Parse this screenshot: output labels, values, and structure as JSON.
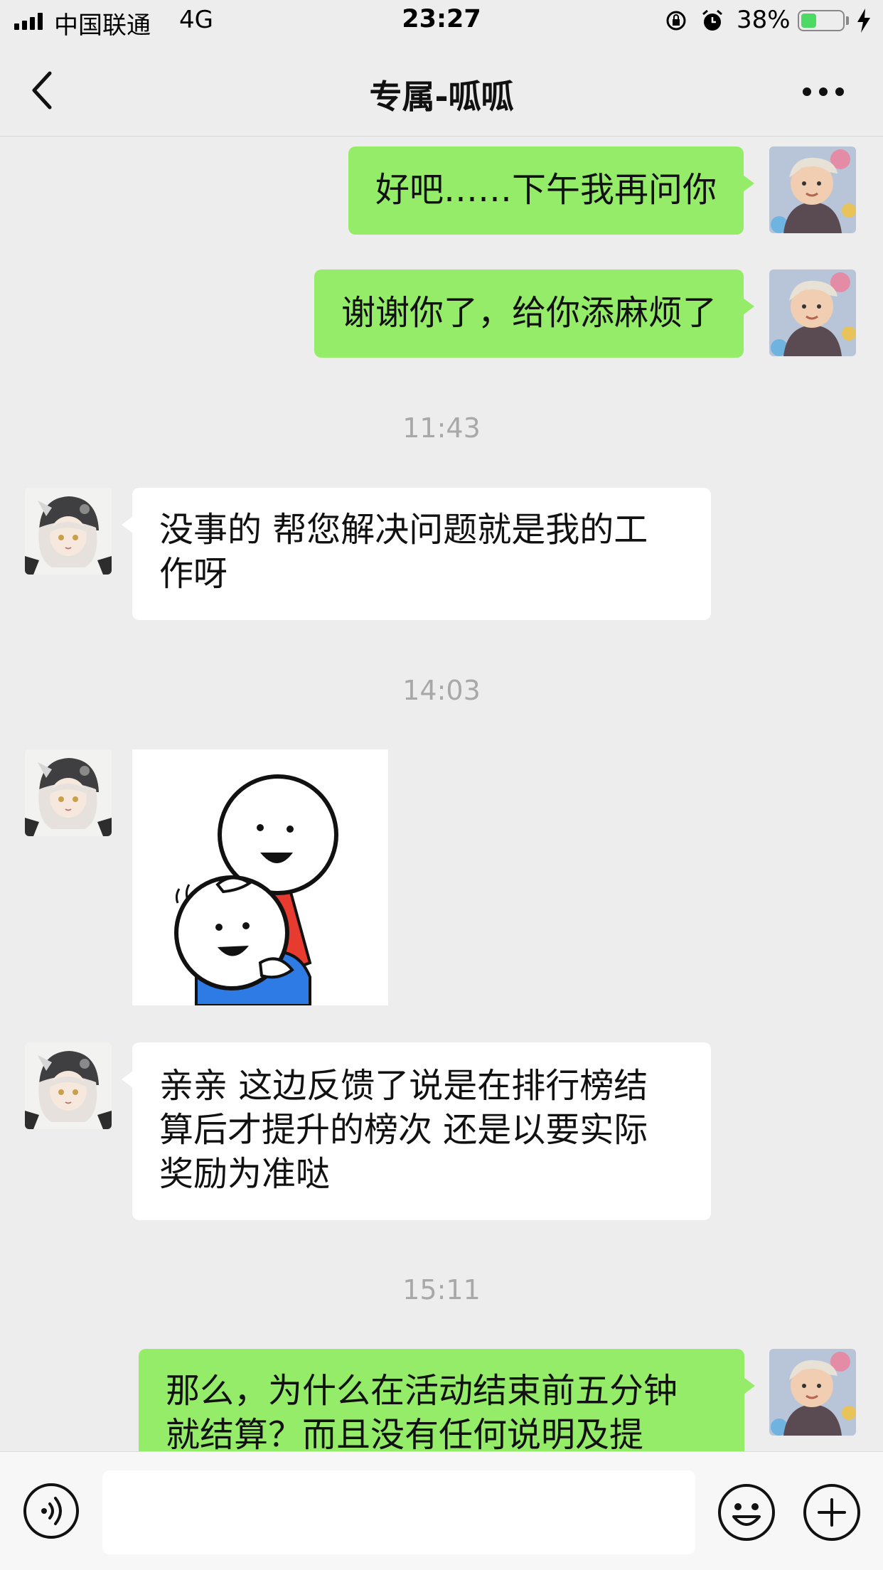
{
  "status_bar": {
    "carrier": "中国联通",
    "network": "4G",
    "time": "23:27",
    "battery_percent": "38%",
    "battery_level": 0.38,
    "battery_color": "#4cd964"
  },
  "nav": {
    "title": "专属-呱呱",
    "back_icon": "chevron-left-icon",
    "more_icon": "more-dots-icon"
  },
  "colors": {
    "outgoing_bubble": "#95ec69",
    "incoming_bubble": "#ffffff",
    "background": "#ededed"
  },
  "messages": [
    {
      "side": "outgoing",
      "text": "好吧……下午我再问你"
    },
    {
      "side": "outgoing",
      "text": "谢谢你了，给你添麻烦了"
    },
    {
      "type": "timestamp",
      "text": "11:43"
    },
    {
      "side": "incoming",
      "line1": "没事的 帮您解决问题就是我的工",
      "line2": "作呀"
    },
    {
      "type": "timestamp",
      "text": "14:03"
    },
    {
      "side": "incoming",
      "type": "sticker"
    },
    {
      "side": "incoming",
      "line1": "亲亲 这边反馈了说是在排行榜结",
      "line2": "算后才提升的榜次 还是以要实际",
      "line3": "奖励为准哒"
    },
    {
      "type": "timestamp",
      "text": "15:11"
    },
    {
      "side": "outgoing",
      "line1": "那么，为什么在活动结束前五分钟",
      "line2": "就结算？而且没有任何说明及提"
    }
  ],
  "input_bar": {
    "voice_icon": "voice-icon",
    "input_value": "",
    "emoji_icon": "emoji-icon",
    "plus_icon": "plus-icon"
  }
}
